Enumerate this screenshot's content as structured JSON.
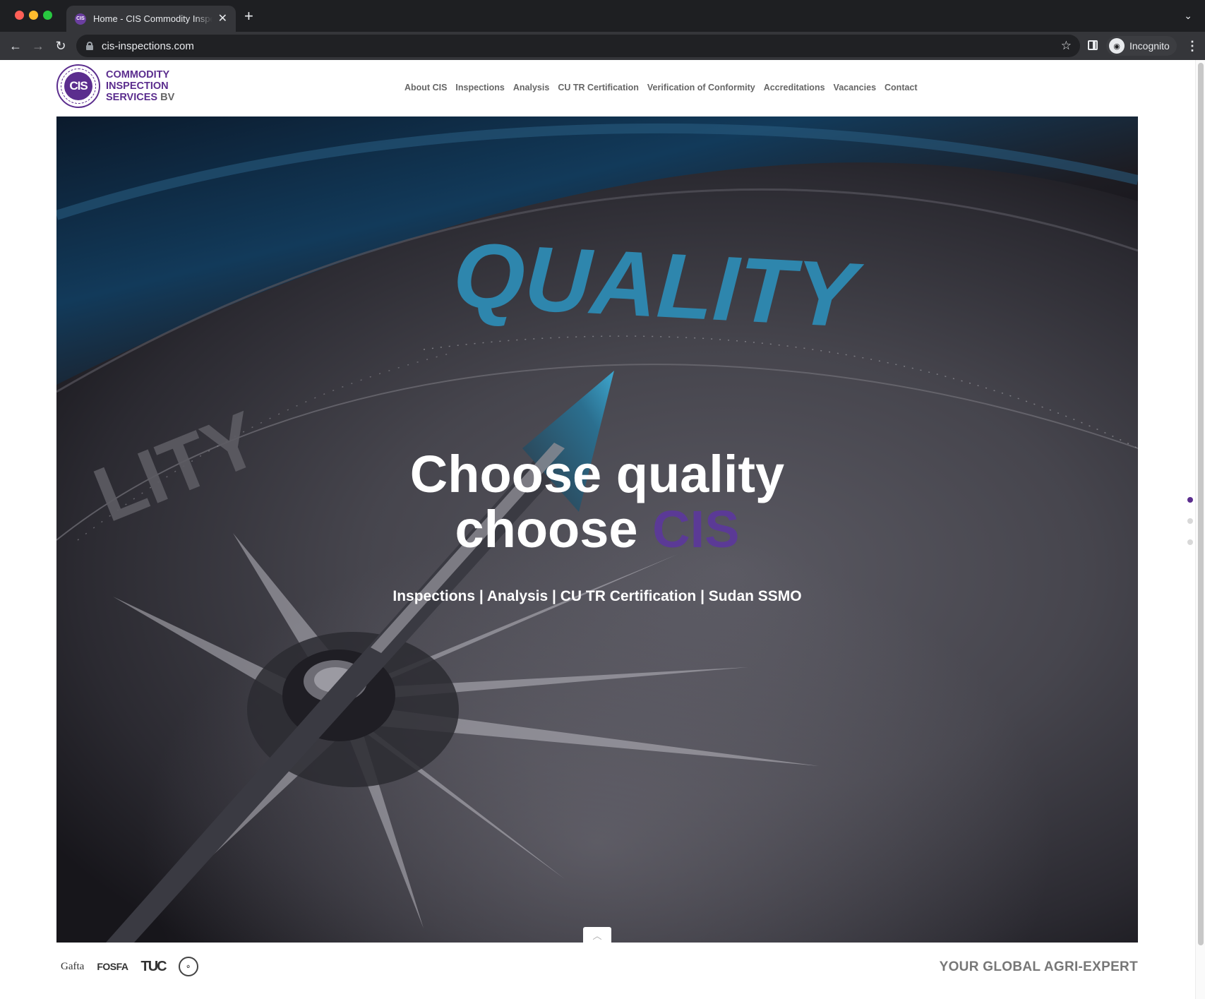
{
  "browser": {
    "tab_title": "Home - CIS Commodity Inspection Services",
    "favicon_text": "CIS",
    "url": "cis-inspections.com",
    "profile_label": "Incognito"
  },
  "site": {
    "logo": {
      "seal_text": "CIS",
      "line1": "COMMODITY",
      "line2": "INSPECTION",
      "line3": "SERVICES",
      "suffix": "BV"
    },
    "nav": [
      "About CIS",
      "Inspections",
      "Analysis",
      "CU TR Certification",
      "Verification of Conformity",
      "Accreditations",
      "Vacancies",
      "Contact"
    ]
  },
  "hero": {
    "background_word": "QUALITY",
    "background_word_partial": "LITY",
    "title_line1": "Choose quality",
    "title_line2_prefix": "choose",
    "title_line2_accent": "CIS",
    "subtitle": "Inspections | Analysis | CU TR Certification | Sudan SSMO",
    "accent_color": "#5b3a96"
  },
  "slider": {
    "active_index": 0,
    "count": 3
  },
  "footer": {
    "accreditations": [
      "Gafta",
      "FOSFA",
      "TUC",
      "seal"
    ],
    "accreditation_labels": {
      "gafta": "Gafta",
      "fosfa": "FOSFA",
      "tuc": "TUC"
    },
    "tagline": "YOUR GLOBAL AGRI-EXPERT"
  }
}
